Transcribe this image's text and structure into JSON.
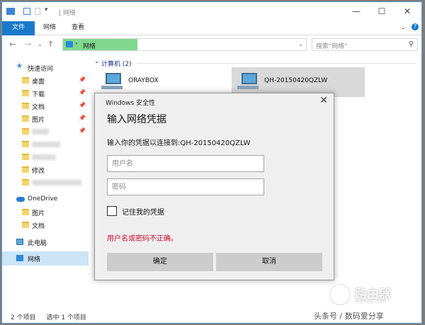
{
  "window": {
    "title": "网络",
    "title_separator": "|"
  },
  "ribbon": {
    "tabs": [
      "文件",
      "网络",
      "查看"
    ]
  },
  "address": {
    "path": "网络",
    "search_placeholder": "搜索\"网络\""
  },
  "sidebar": {
    "quick_access": "快速访问",
    "items": [
      "桌面",
      "下载",
      "文档",
      "图片",
      "修改"
    ],
    "onedrive": "OneDrive",
    "onedrive_items": [
      "图片",
      "文档"
    ],
    "this_pc": "此电脑",
    "network": "网络"
  },
  "main": {
    "group_header": "计算机 (2)",
    "computers": [
      "ORAYBOX",
      "QH-20150420QZLW"
    ]
  },
  "status": {
    "count": "2 个项目",
    "selected": "选中 1 个项目"
  },
  "dialog": {
    "title": "Windows 安全性",
    "heading": "输入网络凭据",
    "subtitle": "输入你的凭据以连接到:QH-20150420QZLW",
    "username_placeholder": "用户名",
    "password_placeholder": "密码",
    "remember": "记住我的凭据",
    "error": "用户名或密码不正确。",
    "ok": "确定",
    "cancel": "取消"
  },
  "watermark": {
    "logo_title": "路由器",
    "logo_sub": "luyouqi.com",
    "bottom": "头条号 / 数码爱分享"
  },
  "colors": {
    "accent": "#1979ca",
    "error": "#c8102e",
    "address_highlight": "#7fd88e"
  }
}
